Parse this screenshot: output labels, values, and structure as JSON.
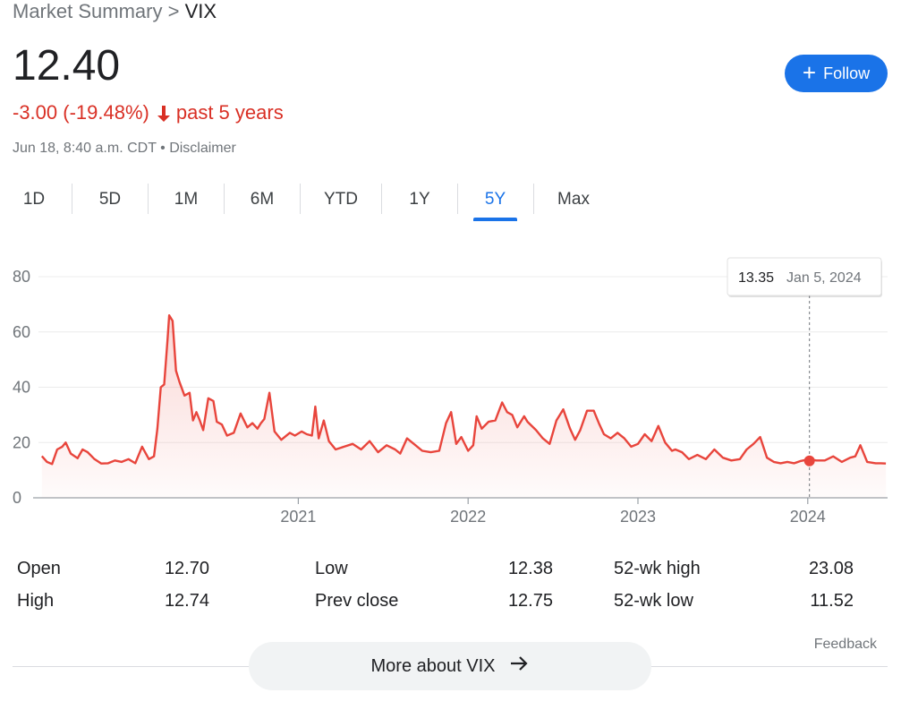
{
  "breadcrumb": {
    "parent": "Market Summary",
    "separator": ">",
    "current": "VIX"
  },
  "quote": {
    "price": "12.40",
    "change": "-3.00 (-19.48%)",
    "period": "past 5 years",
    "timestamp": "Jun 18, 8:40 a.m. CDT",
    "disclaimer": "Disclaimer",
    "bullet": "•"
  },
  "follow": {
    "icon": "plus-icon",
    "label": "Follow"
  },
  "tabs": [
    {
      "label": "1D",
      "active": false
    },
    {
      "label": "5D",
      "active": false
    },
    {
      "label": "1M",
      "active": false
    },
    {
      "label": "6M",
      "active": false
    },
    {
      "label": "YTD",
      "active": false
    },
    {
      "label": "1Y",
      "active": false
    },
    {
      "label": "5Y",
      "active": true
    },
    {
      "label": "Max",
      "active": false
    }
  ],
  "colors": {
    "line": "#e8453c",
    "fill": "#fbe3e1",
    "accent": "#1a73e8",
    "down": "#d93025"
  },
  "chart_data": {
    "type": "area",
    "y_ticks": [
      0,
      20,
      40,
      60,
      80
    ],
    "ylim": [
      0,
      80
    ],
    "x_ticks": [
      "2021",
      "2022",
      "2023",
      "2024"
    ],
    "grid": true,
    "tooltip": {
      "value": "13.35",
      "date": "Jan 5, 2024",
      "t": 2024.01
    },
    "series": [
      {
        "x": [
          2019.49,
          2019.52,
          2019.55,
          2019.58,
          2019.61,
          2019.63,
          2019.66,
          2019.7,
          2019.73,
          2019.76,
          2019.8,
          2019.84,
          2019.88,
          2019.92,
          2019.96,
          2020.0,
          2020.04,
          2020.08,
          2020.12,
          2020.15,
          2020.17,
          2020.19,
          2020.21,
          2020.23,
          2020.24,
          2020.26,
          2020.28,
          2020.3,
          2020.33,
          2020.36,
          2020.38,
          2020.4,
          2020.42,
          2020.44,
          2020.47,
          2020.5,
          2020.52,
          2020.55,
          2020.58,
          2020.62,
          2020.66,
          2020.7,
          2020.73,
          2020.76,
          2020.78,
          2020.8,
          2020.83,
          2020.86,
          2020.9,
          2020.95,
          2020.98,
          2021.02,
          2021.05,
          2021.08,
          2021.1,
          2021.12,
          2021.15,
          2021.18,
          2021.22,
          2021.27,
          2021.32,
          2021.37,
          2021.42,
          2021.47,
          2021.52,
          2021.57,
          2021.6,
          2021.64,
          2021.69,
          2021.73,
          2021.78,
          2021.83,
          2021.87,
          2021.9,
          2021.93,
          2021.96,
          2022.0,
          2022.03,
          2022.05,
          2022.08,
          2022.12,
          2022.16,
          2022.2,
          2022.23,
          2022.26,
          2022.29,
          2022.33,
          2022.35,
          2022.4,
          2022.44,
          2022.48,
          2022.52,
          2022.56,
          2022.6,
          2022.63,
          2022.66,
          2022.7,
          2022.74,
          2022.77,
          2022.8,
          2022.84,
          2022.88,
          2022.92,
          2022.96,
          2023.0,
          2023.04,
          2023.08,
          2023.12,
          2023.16,
          2023.2,
          2023.22,
          2023.26,
          2023.3,
          2023.35,
          2023.4,
          2023.45,
          2023.5,
          2023.55,
          2023.6,
          2023.64,
          2023.68,
          2023.72,
          2023.76,
          2023.8,
          2023.84,
          2023.88,
          2023.92,
          2023.96,
          2024.01,
          2024.05,
          2024.1,
          2024.15,
          2024.2,
          2024.25,
          2024.28,
          2024.31,
          2024.35,
          2024.4,
          2024.43,
          2024.46
        ],
        "y": [
          15.1,
          13.0,
          12.2,
          17.5,
          18.5,
          20.0,
          16.0,
          14.3,
          17.5,
          16.5,
          14.0,
          12.4,
          12.5,
          13.5,
          13.0,
          14.0,
          12.5,
          18.5,
          14.0,
          15.0,
          25.0,
          40.0,
          41.0,
          57.0,
          66.0,
          64.0,
          46.0,
          42.0,
          37.0,
          38.0,
          28.0,
          31.0,
          28.0,
          24.5,
          36.0,
          35.0,
          27.5,
          26.5,
          22.5,
          23.5,
          30.5,
          25.5,
          27.0,
          25.0,
          27.0,
          28.5,
          38.0,
          24.0,
          21.0,
          23.5,
          22.5,
          24.0,
          23.0,
          22.5,
          33.0,
          21.5,
          28.0,
          20.5,
          17.5,
          18.5,
          19.5,
          17.5,
          20.5,
          16.5,
          19.0,
          17.5,
          16.0,
          21.5,
          19.0,
          17.0,
          16.5,
          17.0,
          27.0,
          31.0,
          19.5,
          22.0,
          17.0,
          19.0,
          29.5,
          25.0,
          27.5,
          28.0,
          34.5,
          31.0,
          30.0,
          25.5,
          29.5,
          27.5,
          24.5,
          21.5,
          19.5,
          28.0,
          32.0,
          25.0,
          21.0,
          24.5,
          31.5,
          31.5,
          27.0,
          23.0,
          21.5,
          23.5,
          21.5,
          18.5,
          19.5,
          23.0,
          20.5,
          26.0,
          20.0,
          17.0,
          17.5,
          16.5,
          14.0,
          15.5,
          14.0,
          17.5,
          14.5,
          13.5,
          14.0,
          17.5,
          19.5,
          22.0,
          14.5,
          13.0,
          12.5,
          13.0,
          12.5,
          13.35,
          14.0,
          13.5,
          13.5,
          15.0,
          13.0,
          14.5,
          15.0,
          19.0,
          13.0,
          12.5,
          12.5,
          12.4
        ]
      }
    ]
  },
  "stats": [
    {
      "label": "Open",
      "value": "12.70"
    },
    {
      "label": "High",
      "value": "12.74"
    },
    {
      "label": "Low",
      "value": "12.38"
    },
    {
      "label": "Prev close",
      "value": "12.75"
    },
    {
      "label": "52-wk high",
      "value": "23.08"
    },
    {
      "label": "52-wk low",
      "value": "11.52"
    }
  ],
  "footer": {
    "feedback": "Feedback",
    "more": "More about VIX",
    "more_icon": "arrow-right-icon"
  }
}
